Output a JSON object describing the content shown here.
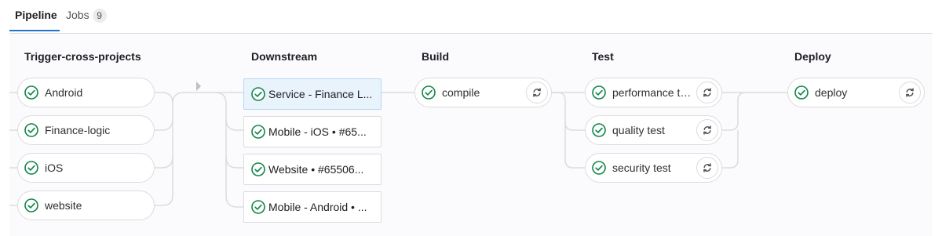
{
  "tabs": {
    "pipeline_label": "Pipeline",
    "jobs_label": "Jobs",
    "jobs_count": "9"
  },
  "stages": {
    "trigger": {
      "title": "Trigger-cross-projects",
      "jobs": [
        {
          "label": "Android",
          "status": "passed"
        },
        {
          "label": "Finance-logic",
          "status": "passed"
        },
        {
          "label": "iOS",
          "status": "passed"
        },
        {
          "label": "website",
          "status": "passed"
        }
      ]
    },
    "downstream": {
      "title": "Downstream",
      "pipelines": [
        {
          "label": "Service - Finance L...",
          "status": "passed",
          "selected": true
        },
        {
          "label": "Mobile - iOS • #65...",
          "status": "passed"
        },
        {
          "label": "Website • #65506...",
          "status": "passed"
        },
        {
          "label": "Mobile - Android • ...",
          "status": "passed"
        }
      ]
    },
    "build": {
      "title": "Build",
      "jobs": [
        {
          "label": "compile",
          "status": "passed",
          "action": "retry-icon"
        }
      ]
    },
    "test": {
      "title": "Test",
      "jobs": [
        {
          "label": "performance test",
          "status": "passed",
          "action": "retry-icon"
        },
        {
          "label": "quality test",
          "status": "passed",
          "action": "retry-icon"
        },
        {
          "label": "security test",
          "status": "passed",
          "action": "retry-icon"
        }
      ]
    },
    "deploy": {
      "title": "Deploy",
      "jobs": [
        {
          "label": "deploy",
          "status": "passed",
          "action": "retry-icon"
        }
      ]
    }
  },
  "colors": {
    "success": "#108548",
    "active_tab": "#1f75cb",
    "link_line": "#dcdcde",
    "selected_bg": "#e9f3fc"
  }
}
